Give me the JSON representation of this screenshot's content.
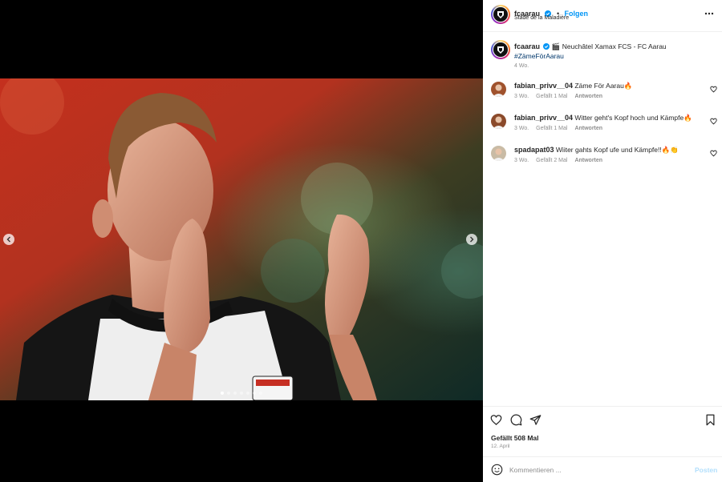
{
  "account": {
    "username": "fcaarau",
    "follow_label": "Folgen",
    "separator": "•",
    "location": "Stade de la Maladière"
  },
  "caption": {
    "emoji": "🎬",
    "text": "Neuchâtel Xamax FCS - FC Aarau",
    "hashtag": "#ZämeFörAarau",
    "time": "4 Wo."
  },
  "comments": [
    {
      "username": "fabian_privv__04",
      "text": "Zäme För Aarau",
      "emoji": "🔥",
      "time": "3 Wo.",
      "likes": "Gefällt 1 Mal",
      "reply": "Antworten"
    },
    {
      "username": "fabian_privv__04",
      "text": "Witter geht's Kopf hoch und Kämpfe",
      "emoji": "🔥",
      "time": "3 Wo.",
      "likes": "Gefällt 1 Mal",
      "reply": "Antworten"
    },
    {
      "username": "spadapat03",
      "text": "Wiiter gahts Kopf ufe und Kämpfe!!",
      "emoji": "🔥👏",
      "time": "3 Wo.",
      "likes": "Gefällt 2 Mal",
      "reply": "Antworten"
    }
  ],
  "likes_label": "Gefällt 508 Mal",
  "date": "12. April",
  "comment_box": {
    "placeholder": "Kommentieren ...",
    "post_label": "Posten"
  },
  "carousel": {
    "slide_count": 7,
    "active_slide": 1
  },
  "colors": {
    "link_blue": "#0095f6",
    "hashtag_blue": "#00376b",
    "meta_gray": "#8e8e8e",
    "post_disabled": "#b2dffc"
  }
}
